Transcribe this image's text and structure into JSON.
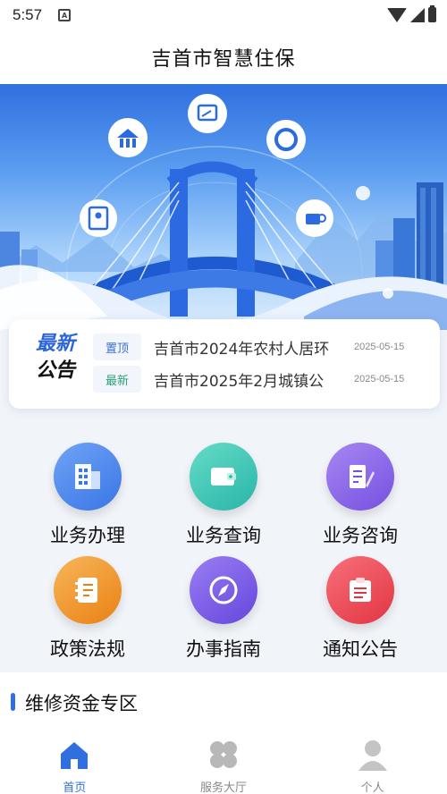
{
  "status": {
    "time": "5:57",
    "notif_glyph": "A"
  },
  "header": {
    "title": "吉首市智慧住保"
  },
  "announcement": {
    "badge_top": "最新",
    "badge_bottom": "公告",
    "items": [
      {
        "tag": "置顶",
        "text": "吉首市2024年农村人居环",
        "date": "2025-05-15"
      },
      {
        "tag": "最新",
        "text": "吉首市2025年2月城镇公",
        "date": "2025-05-15"
      }
    ]
  },
  "services": [
    {
      "label": "业务办理",
      "icon": "building-icon",
      "color": "#4f8bf0"
    },
    {
      "label": "业务查询",
      "icon": "wallet-icon",
      "color": "#3fc6b5"
    },
    {
      "label": "业务咨询",
      "icon": "notepad-pen-icon",
      "color": "#8b63e8"
    },
    {
      "label": "政策法规",
      "icon": "document-book-icon",
      "color": "#f0962a"
    },
    {
      "label": "办事指南",
      "icon": "compass-icon",
      "color": "#7d5ce8"
    },
    {
      "label": "通知公告",
      "icon": "notice-icon",
      "color": "#ef4a55"
    }
  ],
  "section": {
    "title": "维修资金专区"
  },
  "nav": [
    {
      "label": "首页",
      "icon": "home-icon",
      "active": true
    },
    {
      "label": "服务大厅",
      "icon": "grid-clover-icon",
      "active": false
    },
    {
      "label": "个人",
      "icon": "person-icon",
      "active": false
    }
  ],
  "colors": {
    "accent": "#2f6fe0",
    "nav_inactive": "#888888"
  }
}
